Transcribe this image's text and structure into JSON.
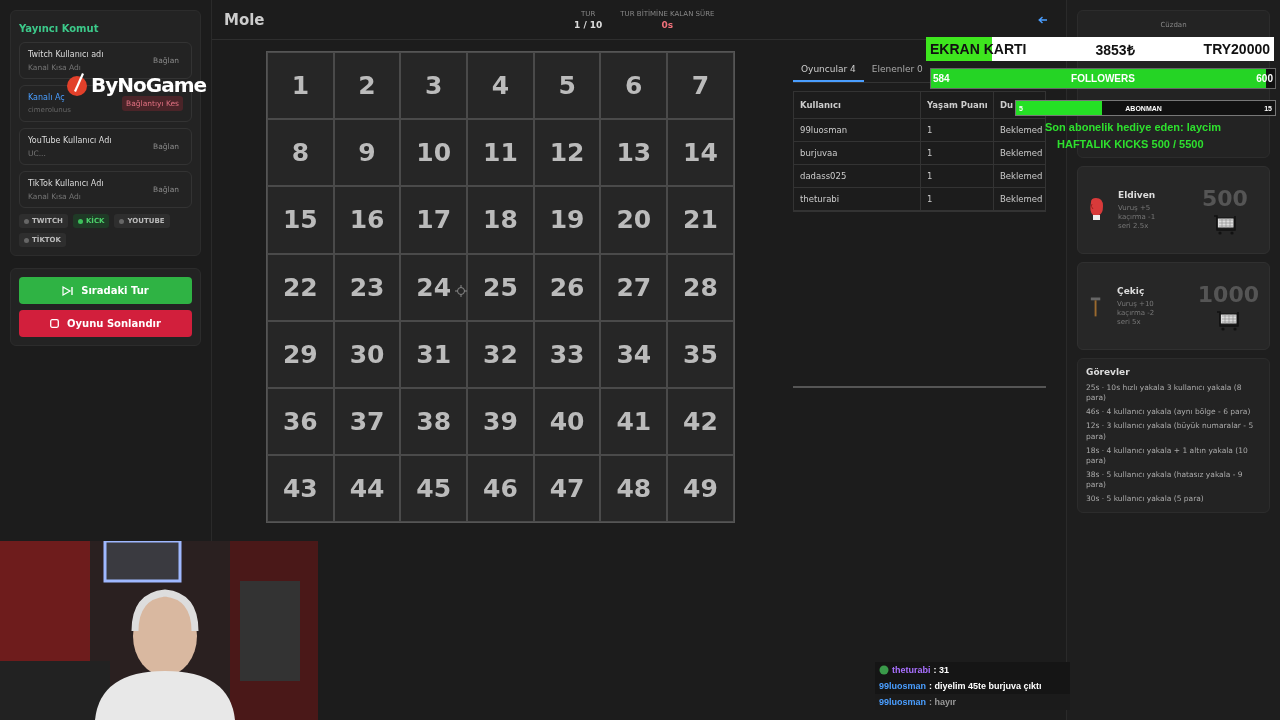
{
  "sidebar": {
    "title": "Yayıncı Komut",
    "connections": [
      {
        "kind": "input",
        "label": "Twitch Kullanıcı adı",
        "placeholder": "Kanal Kısa Adı",
        "button": "Bağlan",
        "connected": false
      },
      {
        "kind": "link",
        "label": "Kanalı Aç",
        "value": "cimerolunus",
        "button": "Bağlantıyı Kes",
        "connected": true
      },
      {
        "kind": "input",
        "label": "YouTube Kullanıcı Adı",
        "placeholder": "UC...",
        "button": "Bağlan",
        "connected": false
      },
      {
        "kind": "input",
        "label": "TikTok Kullanıcı Adı",
        "placeholder": "Kanal Kısa Adı",
        "button": "Bağlan",
        "connected": false
      }
    ],
    "platforms": [
      {
        "label": "TWITCH",
        "on": false
      },
      {
        "label": "KİCK",
        "on": true
      },
      {
        "label": "YOUTUBE",
        "on": false
      },
      {
        "label": "TİKTOK",
        "on": false
      }
    ],
    "actions": [
      {
        "kind": "next",
        "label": "Sıradaki Tur"
      },
      {
        "kind": "end",
        "label": "Oyunu Sonlandır"
      }
    ]
  },
  "header": {
    "title": "Mole",
    "round_label": "TUR",
    "round": "1 / 10",
    "timer_label": "TUR BİTİMİNE KALAN SÜRE",
    "timer": "0s"
  },
  "board": {
    "cells": [
      "1",
      "2",
      "3",
      "4",
      "5",
      "6",
      "7",
      "8",
      "9",
      "10",
      "11",
      "12",
      "13",
      "14",
      "15",
      "16",
      "17",
      "18",
      "19",
      "20",
      "21",
      "22",
      "23",
      "24",
      "25",
      "26",
      "27",
      "28",
      "29",
      "30",
      "31",
      "32",
      "33",
      "34",
      "35",
      "36",
      "37",
      "38",
      "39",
      "40",
      "41",
      "42",
      "43",
      "44",
      "45",
      "46",
      "47",
      "48",
      "49"
    ]
  },
  "players": {
    "tabs": [
      {
        "label": "Oyuncular 4",
        "selected": true
      },
      {
        "label": "Elenenler 0",
        "selected": false
      }
    ],
    "columns": [
      "Kullanıcı",
      "Yaşam Puanı",
      "Du"
    ],
    "rows": [
      [
        "99luosman",
        "1",
        "Beklemed"
      ],
      [
        "burjuvaa",
        "1",
        "Beklemed"
      ],
      [
        "dadass025",
        "1",
        "Beklemed"
      ],
      [
        "theturabi",
        "1",
        "Beklemed"
      ]
    ]
  },
  "wallet": {
    "title": "Cüzdan"
  },
  "shop": [
    {
      "kind": "glove",
      "name": "Eldiven",
      "lines": [
        "Vuruş +5",
        "kaçırma -1",
        "seri 2.5x"
      ],
      "price": "500"
    },
    {
      "kind": "hammer",
      "name": "Çekiç",
      "lines": [
        "Vuruş +10",
        "kaçırma -2",
        "seri 5x"
      ],
      "price": "1000"
    }
  ],
  "tasks": {
    "title": "Görevler",
    "items": [
      "25s · 10s hızlı yakala 3 kullanıcı yakala (8 para)",
      "46s · 4 kullanıcı yakala (aynı bölge - 6 para)",
      "12s · 3 kullanıcı yakala (büyük numaralar - 5 para)",
      "18s · 4 kullanıcı yakala + 1 altın yakala (10 para)",
      "38s · 5 kullanıcı yakala (hatasız yakala - 9 para)",
      "30s · 5 kullanıcı yakala (5 para)"
    ]
  },
  "chat": [
    {
      "user": "theturabi",
      "text": ": 31",
      "color": "#a970ff",
      "badge": true,
      "dim": false
    },
    {
      "user": "99luosman",
      "text": ": diyelim 45te burjuva çıktı",
      "color": "#4a9eff",
      "badge": false,
      "dim": false
    },
    {
      "user": "99luosman",
      "text": ": hayır",
      "color": "#4a9eff",
      "badge": false,
      "dim": true
    }
  ],
  "overlay": {
    "logo": "ByNoGame",
    "goal": {
      "label": "EKRAN KARTI",
      "amount": "3853₺",
      "target": "TRY20000",
      "level": 0.19
    },
    "followers": {
      "current": "584",
      "label": "FOLLOWERS",
      "target": "600",
      "level": 0.973
    },
    "subs": {
      "current": "5",
      "label": "ABONMAN",
      "target": "15",
      "level": 0.333
    },
    "last_gift": "Son abonelik hediye eden: laycim",
    "weekly": "HAFTALIK KICKS 500 / 5500"
  }
}
